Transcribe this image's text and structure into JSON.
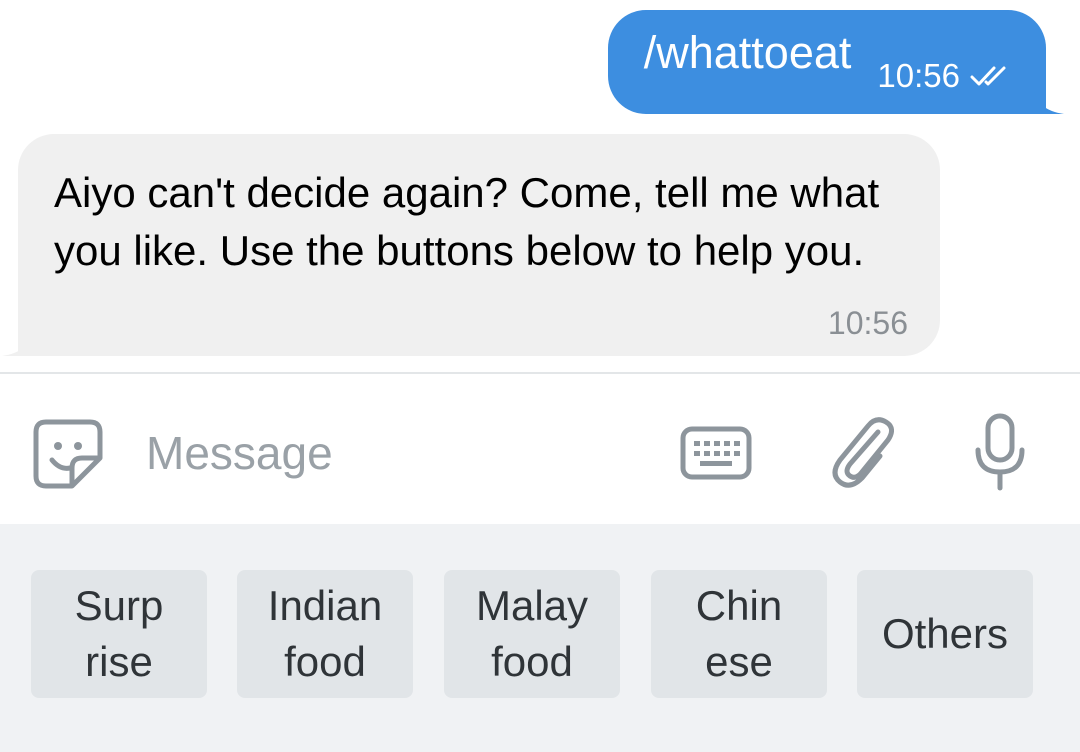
{
  "messages": {
    "outgoing": {
      "text": "/whattoeat",
      "time": "10:56",
      "status_icon": "double-check-icon"
    },
    "incoming": {
      "text": "Aiyo can't decide again? Come, tell me what you like. Use the buttons below to help you.",
      "time": "10:56"
    }
  },
  "input": {
    "placeholder": "Message",
    "icons": [
      "sticker-icon",
      "keyboard-icon",
      "attach-icon",
      "microphone-icon"
    ]
  },
  "reply_keyboard": {
    "buttons": [
      {
        "label": "Surp\nrise"
      },
      {
        "label": "Indian\nfood"
      },
      {
        "label": "Malay\nfood"
      },
      {
        "label": "Chin\nese"
      },
      {
        "label": "Others"
      }
    ]
  },
  "colors": {
    "outgoing_bubble": "#3d8ee0",
    "incoming_bubble": "#f0f0f0",
    "keyboard_background": "#f0f2f4",
    "keyboard_button": "#e1e5e8"
  }
}
